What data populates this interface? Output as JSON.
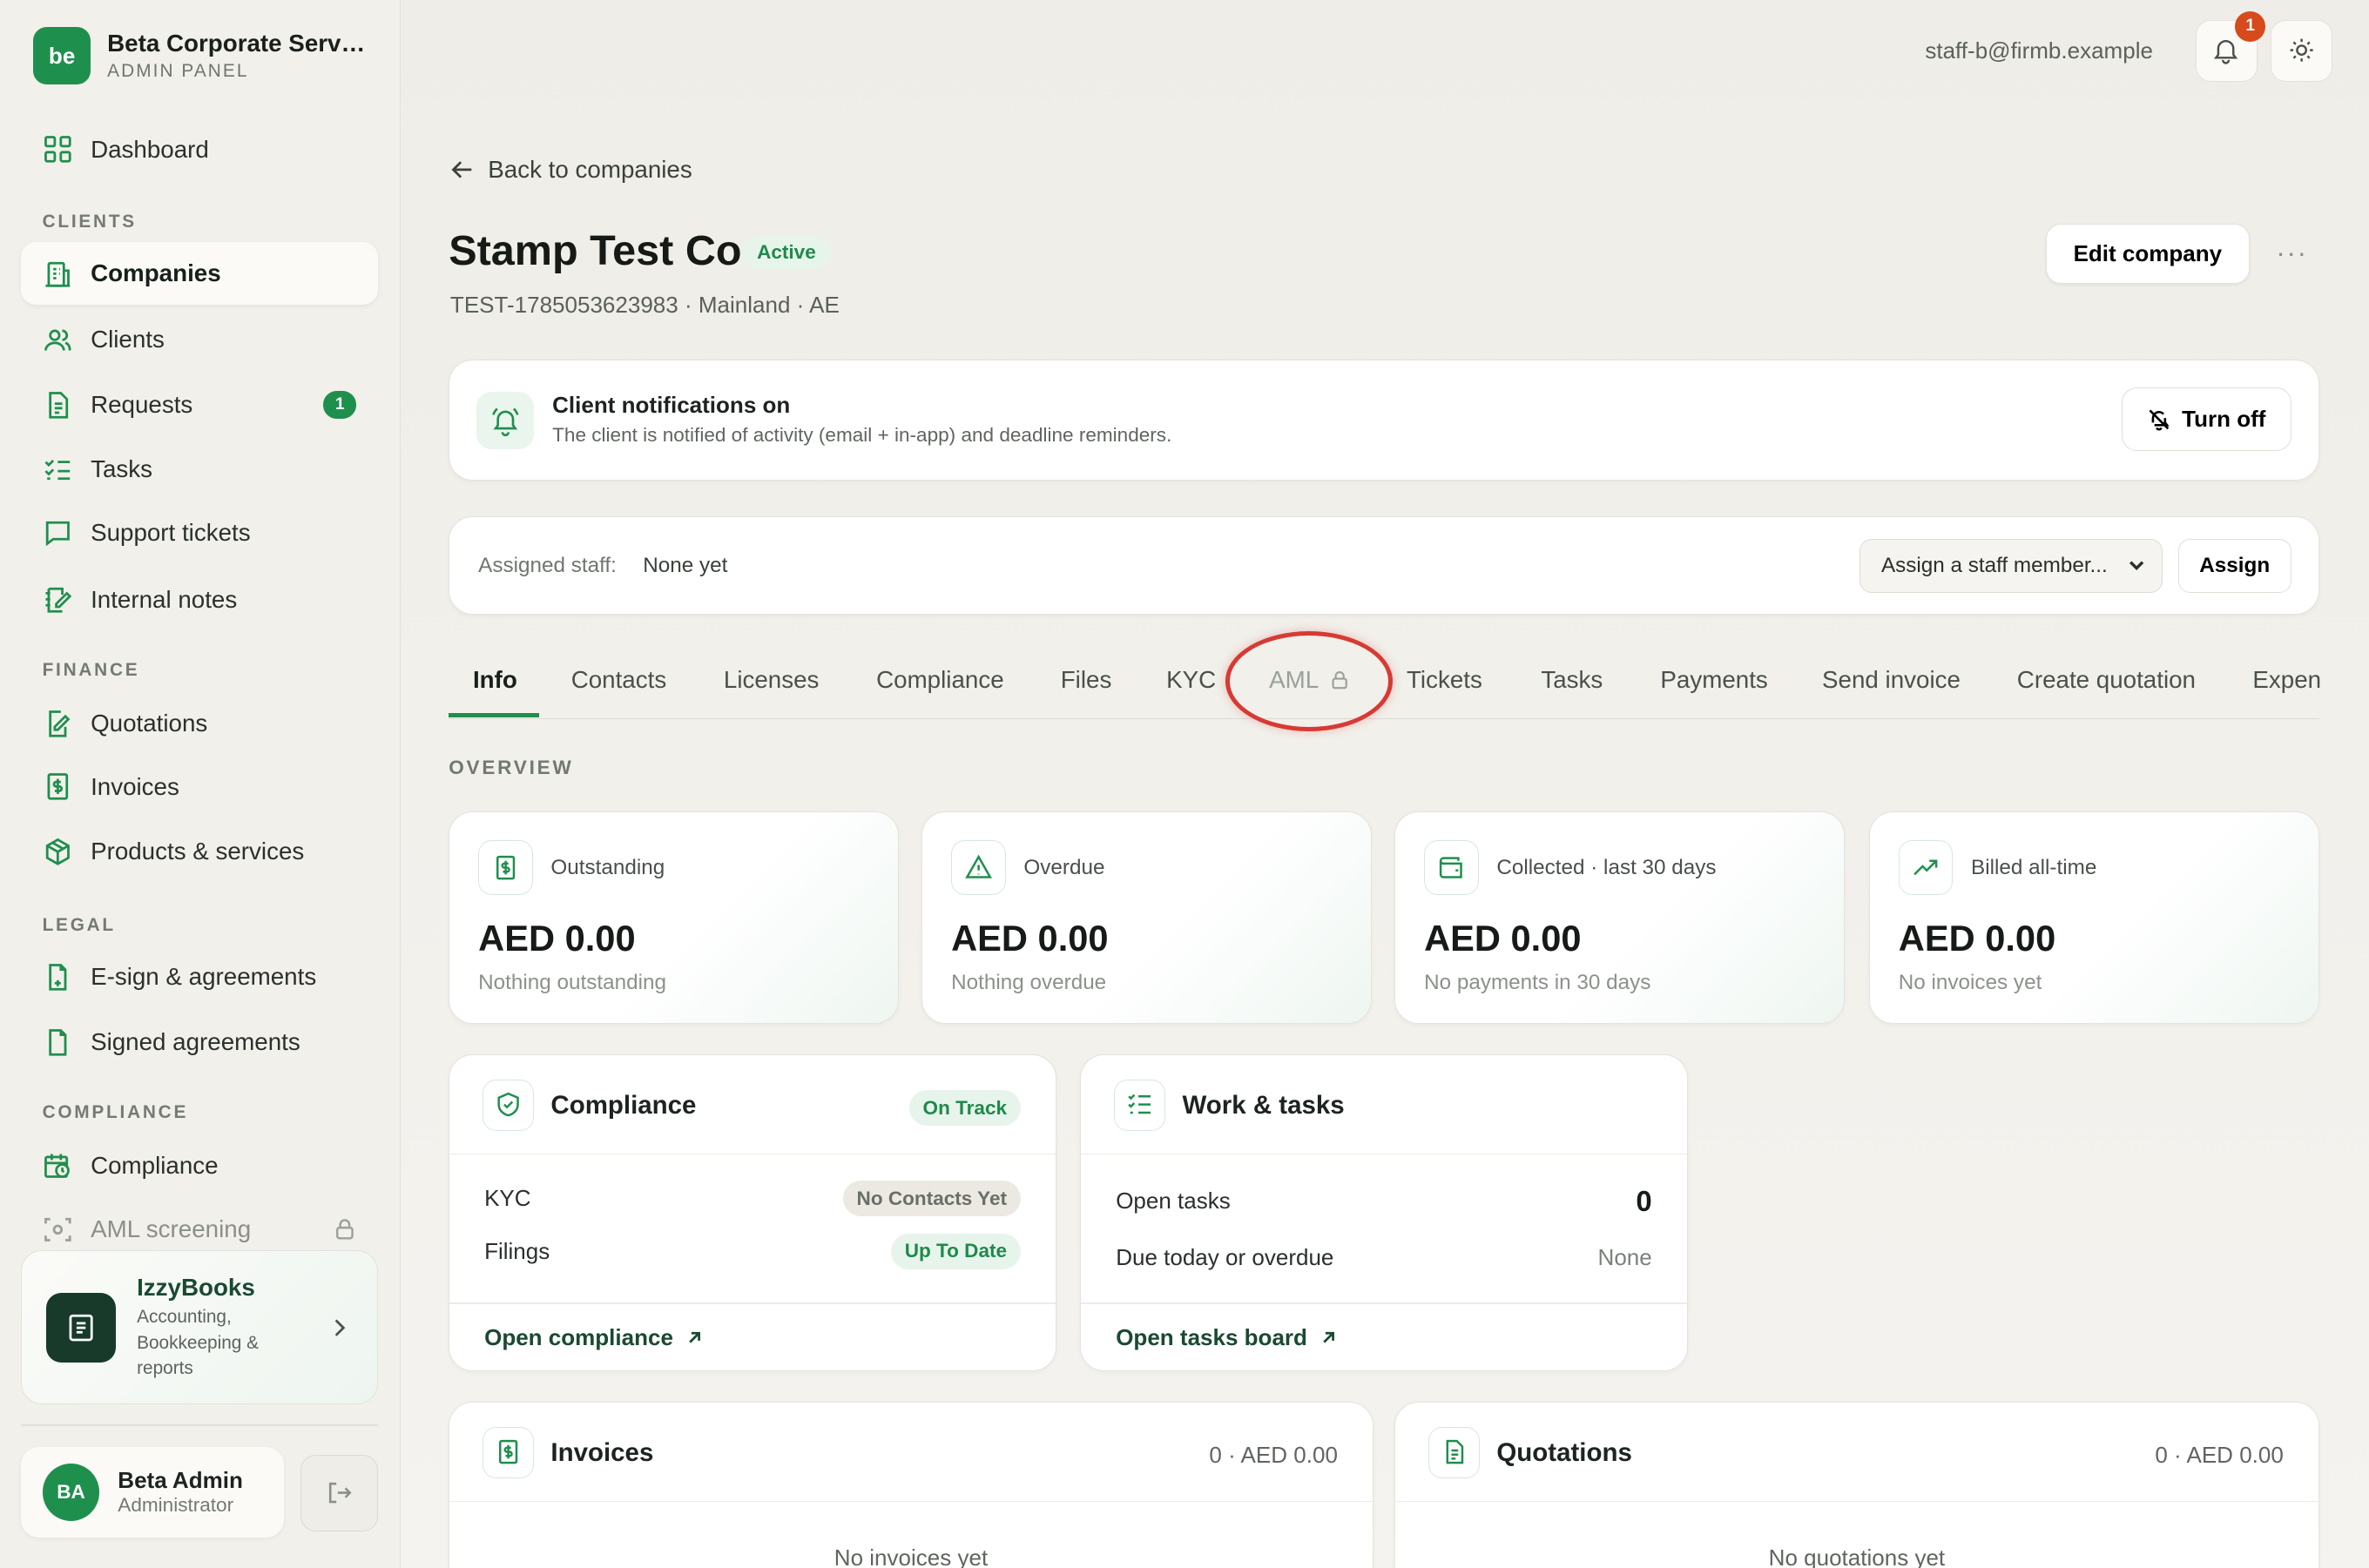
{
  "brand": {
    "logo": "be",
    "name": "Beta Corporate Servi...",
    "subtitle": "ADMIN PANEL"
  },
  "sidebar": {
    "dashboard": {
      "label": "Dashboard",
      "icon": "grid-icon"
    },
    "sections": {
      "clients": "CLIENTS",
      "finance": "FINANCE",
      "legal": "LEGAL",
      "compliance": "COMPLIANCE"
    },
    "items": {
      "companies": {
        "label": "Companies",
        "icon": "building-icon"
      },
      "clients": {
        "label": "Clients",
        "icon": "users-icon"
      },
      "requests": {
        "label": "Requests",
        "icon": "document-icon",
        "badge": "1"
      },
      "tasks": {
        "label": "Tasks",
        "icon": "checklist-icon"
      },
      "support": {
        "label": "Support tickets",
        "icon": "chat-icon"
      },
      "notes": {
        "label": "Internal notes",
        "icon": "note-icon"
      },
      "quotations": {
        "label": "Quotations",
        "icon": "document-edit-icon"
      },
      "invoices": {
        "label": "Invoices",
        "icon": "dollar-document-icon"
      },
      "products": {
        "label": "Products & services",
        "icon": "box-icon"
      },
      "esign": {
        "label": "E-sign & agreements",
        "icon": "file-sign-icon"
      },
      "signed": {
        "label": "Signed agreements",
        "icon": "file-check-icon"
      },
      "compliance": {
        "label": "Compliance",
        "icon": "calendar-clock-icon"
      },
      "aml": {
        "label": "AML screening",
        "icon": "scan-icon"
      }
    },
    "promo": {
      "title": "IzzyBooks",
      "description": "Accounting, Bookkeeping & reports"
    },
    "user": {
      "initials": "BA",
      "name": "Beta Admin",
      "role": "Administrator"
    }
  },
  "topbar": {
    "email": "staff-b@firmb.example",
    "notification_count": "1"
  },
  "header": {
    "back_label": "Back to companies",
    "company_name": "Stamp Test Co",
    "status": "Active",
    "meta": "TEST-1785053623983 · Mainland · AE",
    "edit_label": "Edit company",
    "more_label": "···"
  },
  "notifications_card": {
    "title": "Client notifications on",
    "description": "The client is notified of activity (email + in-app) and deadline reminders.",
    "button_label": "Turn off"
  },
  "staff_card": {
    "label": "Assigned staff:",
    "value": "None yet",
    "select_placeholder": "Assign a staff member...",
    "assign_label": "Assign"
  },
  "tabs": [
    "Info",
    "Contacts",
    "Licenses",
    "Compliance",
    "Files",
    "KYC",
    "AML",
    "Tickets",
    "Tasks",
    "Payments",
    "Send invoice",
    "Create quotation",
    "Expen"
  ],
  "overview": {
    "label": "OVERVIEW",
    "stats": [
      {
        "label": "Outstanding",
        "value": "AED 0.00",
        "sub": "Nothing outstanding",
        "icon": "dollar-document-icon"
      },
      {
        "label": "Overdue",
        "value": "AED 0.00",
        "sub": "Nothing overdue",
        "icon": "warning-icon"
      },
      {
        "label": "Collected · last 30 days",
        "value": "AED 0.00",
        "sub": "No payments in 30 days",
        "icon": "wallet-icon"
      },
      {
        "label": "Billed all-time",
        "value": "AED 0.00",
        "sub": "No invoices yet",
        "icon": "trend-up-icon"
      }
    ]
  },
  "compliance_panel": {
    "title": "Compliance",
    "status": "On Track",
    "rows": [
      {
        "label": "KYC",
        "status": "No Contacts Yet"
      },
      {
        "label": "Filings",
        "status": "Up To Date"
      }
    ],
    "link": "Open compliance"
  },
  "tasks_panel": {
    "title": "Work & tasks",
    "rows": [
      {
        "label": "Open tasks",
        "value": "0"
      },
      {
        "label": "Due today or overdue",
        "value": "None"
      }
    ],
    "link": "Open tasks board"
  },
  "invoices_panel": {
    "title": "Invoices",
    "summary": "0 · AED 0.00",
    "empty": "No invoices yet"
  },
  "quotations_panel": {
    "title": "Quotations",
    "summary": "0 · AED 0.00",
    "empty": "No quotations yet"
  },
  "colors": {
    "accent": "#1f8f4e",
    "highlight_ring": "#d73a34",
    "notification": "#d64a1c"
  }
}
